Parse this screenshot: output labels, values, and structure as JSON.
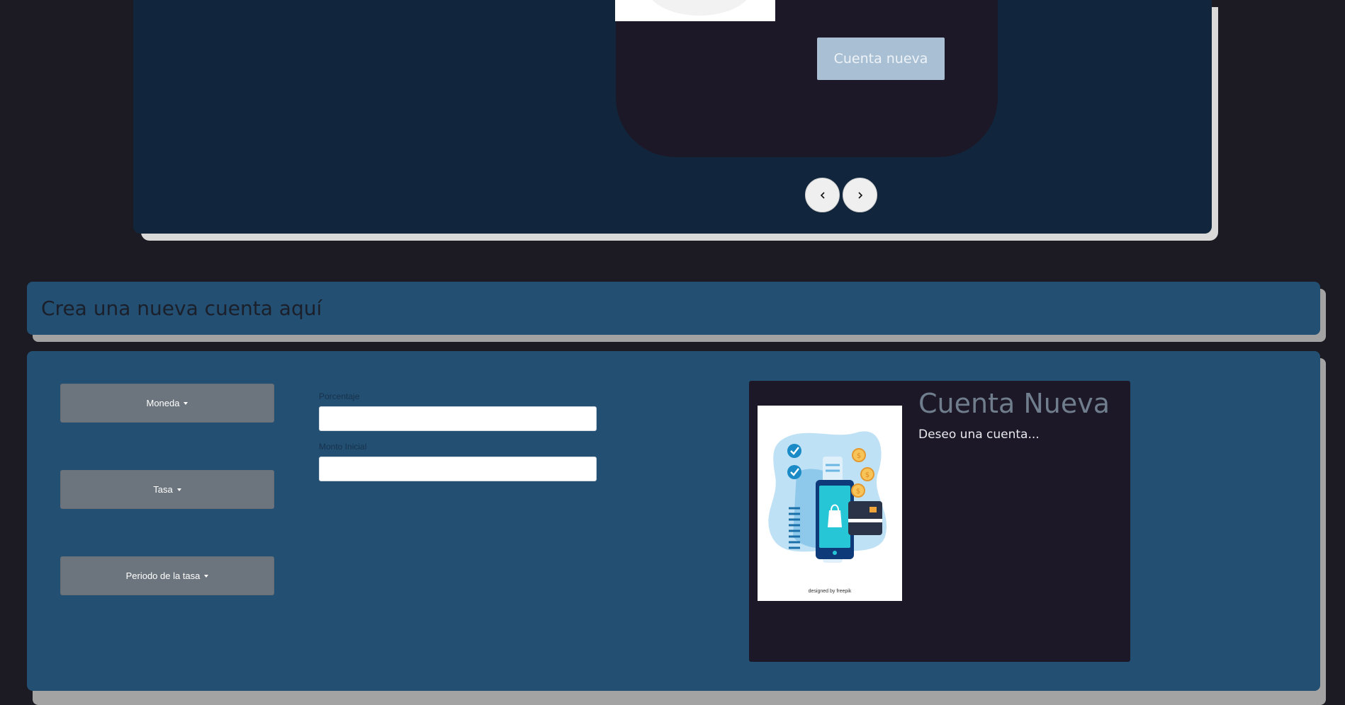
{
  "carousel": {
    "new_account_button_label": "Cuenta nueva",
    "prev_symbol": "‹",
    "next_symbol": "›"
  },
  "header": {
    "title": "Crea una nueva cuenta aquí"
  },
  "form": {
    "dropdowns": [
      {
        "label": "Moneda"
      },
      {
        "label": "Tasa"
      },
      {
        "label": "Periodo de la tasa"
      }
    ],
    "fields": [
      {
        "label": "Porcentaje",
        "value": ""
      },
      {
        "label": "Monto Inicial",
        "value": ""
      }
    ]
  },
  "preview": {
    "title": "Cuenta Nueva",
    "description": "Deseo una cuenta...",
    "image_credit": "designed by freepik"
  },
  "colors": {
    "page_bg": "#1c1a22",
    "carousel_bg": "#11263c",
    "panel_bg": "#234f72",
    "card_bg": "#1c1828",
    "button_gray": "#6c757d",
    "button_light_blue": "#a9bfd3"
  }
}
